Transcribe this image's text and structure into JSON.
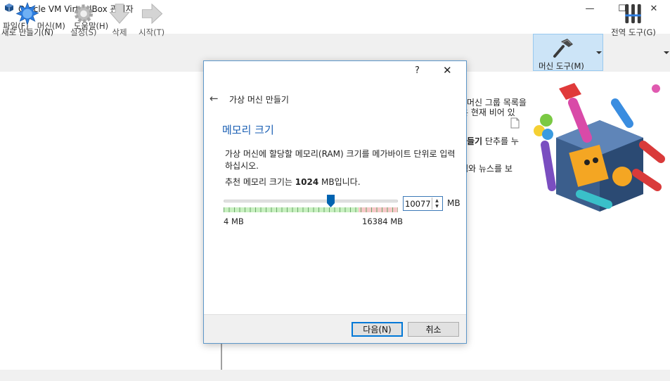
{
  "window": {
    "title": "Oracle VM VirtualBox 관리자",
    "controls": {
      "minimize": "—",
      "maximize": "☐",
      "close": "✕"
    }
  },
  "menubar": {
    "items": [
      {
        "label": "파일(F)"
      },
      {
        "label": "머신(M)"
      },
      {
        "label": "도움말(H)"
      }
    ]
  },
  "toolbar": {
    "new_label": "새로 만들기(N)",
    "settings_label": "설정(S)",
    "discard_label": "삭제",
    "start_label": "시작(T)",
    "machine_tools_label": "머신 도구(M)",
    "global_tools_label": "전역 도구(G)"
  },
  "welcome": {
    "line1": "머신 그룹 목록을",
    "line2": "은 현재 비어 있",
    "line3_bold": "들기",
    "line3": " 단추를 누",
    "line4": "웹와 뉴스를 보"
  },
  "dialog": {
    "help": "?",
    "close": "✕",
    "back": "←",
    "wizard_title": "가상 머신 만들기",
    "heading": "메모리 크기",
    "description": "가상 머신에 할당할 메모리(RAM) 크기를 메가바이트 단위로 입력하십시오.",
    "recommend_prefix": "추천 메모리 크기는 ",
    "recommend_value": "1024",
    "recommend_suffix": " MB입니다.",
    "slider": {
      "min_label": "4 MB",
      "max_label": "16384 MB",
      "min": 4,
      "max": 16384,
      "value": 10077
    },
    "memory_value": "10077",
    "memory_unit": "MB",
    "next_button": "다음(N)",
    "cancel_button": "취소"
  },
  "colors": {
    "accent": "#1a5fb4",
    "selection": "#cce4f7",
    "slider_thumb": "#0063b1"
  }
}
